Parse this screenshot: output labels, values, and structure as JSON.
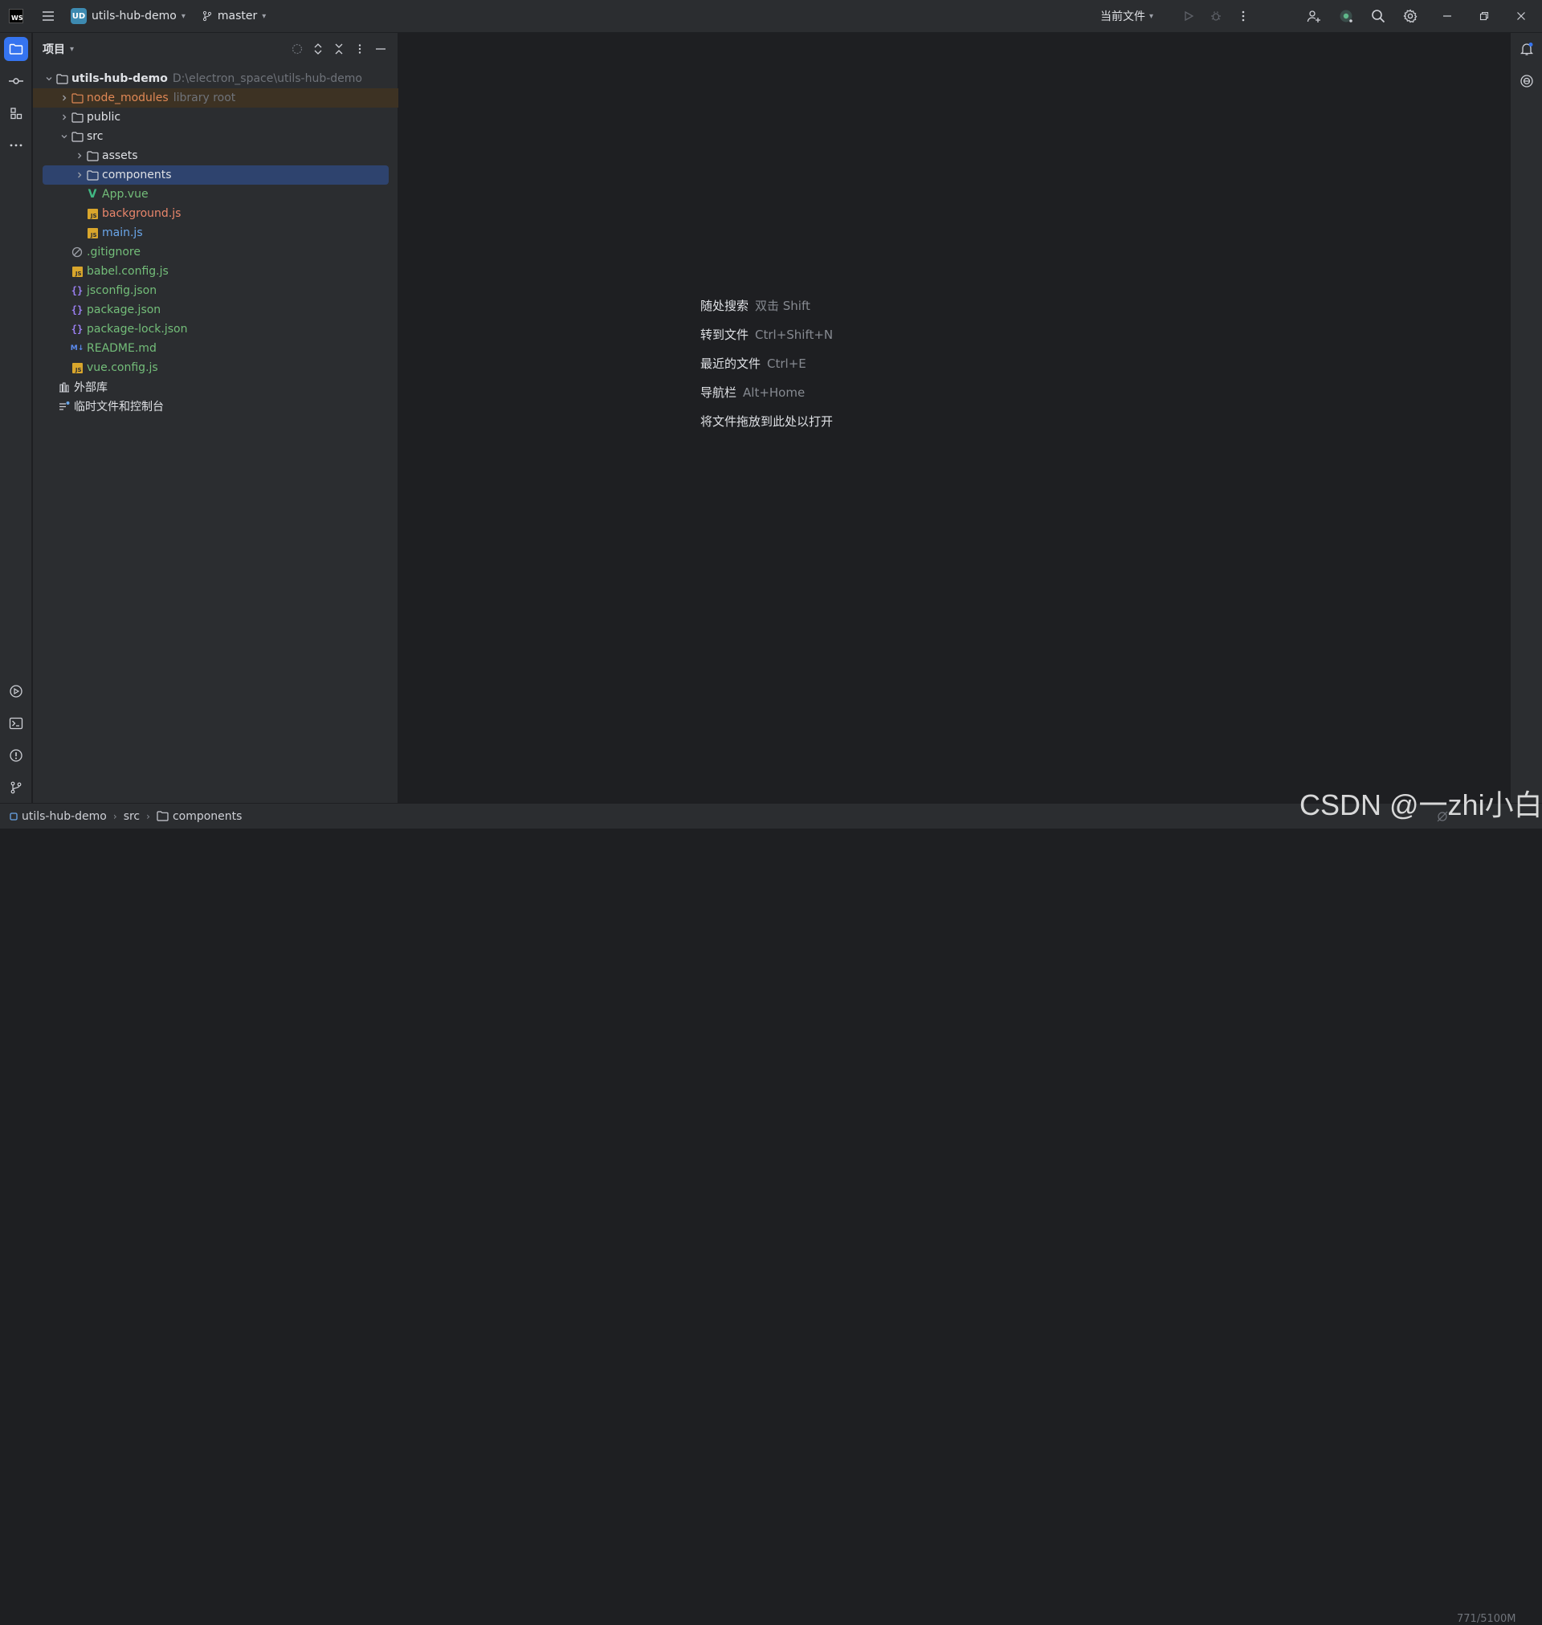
{
  "titlebar": {
    "project_badge": "UD",
    "project_name": "utils-hub-demo",
    "branch": "master",
    "run_config": "当前文件"
  },
  "panel": {
    "title": "项目"
  },
  "tree": {
    "root": {
      "name": "utils-hub-demo",
      "path": "D:\\electron_space\\utils-hub-demo"
    },
    "node_modules": {
      "name": "node_modules",
      "hint": "library root"
    },
    "public": "public",
    "src": "src",
    "assets": "assets",
    "components": "components",
    "app_vue": "App.vue",
    "background_js": "background.js",
    "main_js": "main.js",
    "gitignore": ".gitignore",
    "babel_config": "babel.config.js",
    "jsconfig": "jsconfig.json",
    "package_json": "package.json",
    "package_lock": "package-lock.json",
    "readme": "README.md",
    "vue_config": "vue.config.js",
    "external_libs": "外部库",
    "scratches": "临时文件和控制台"
  },
  "editor_hints": [
    {
      "label": "随处搜索",
      "shortcut": "双击 Shift"
    },
    {
      "label": "转到文件",
      "shortcut": "Ctrl+Shift+N"
    },
    {
      "label": "最近的文件",
      "shortcut": "Ctrl+E"
    },
    {
      "label": "导航栏",
      "shortcut": "Alt+Home"
    },
    {
      "label": "将文件拖放到此处以打开",
      "shortcut": ""
    }
  ],
  "statusbar": {
    "crumbs": [
      "utils-hub-demo",
      "src",
      "components"
    ],
    "memory": "771/5100M"
  },
  "watermark": "CSDN @一zhi小白",
  "colors": {
    "accent": "#3574f0",
    "selection": "#2e436e",
    "library_root_bg": "#3d3223",
    "excluded_folder_text": "#e08855",
    "vcs_added_text": "#73bd79",
    "vcs_modified_text": "#6aa6e9",
    "background_js_text": "#e9866b"
  }
}
